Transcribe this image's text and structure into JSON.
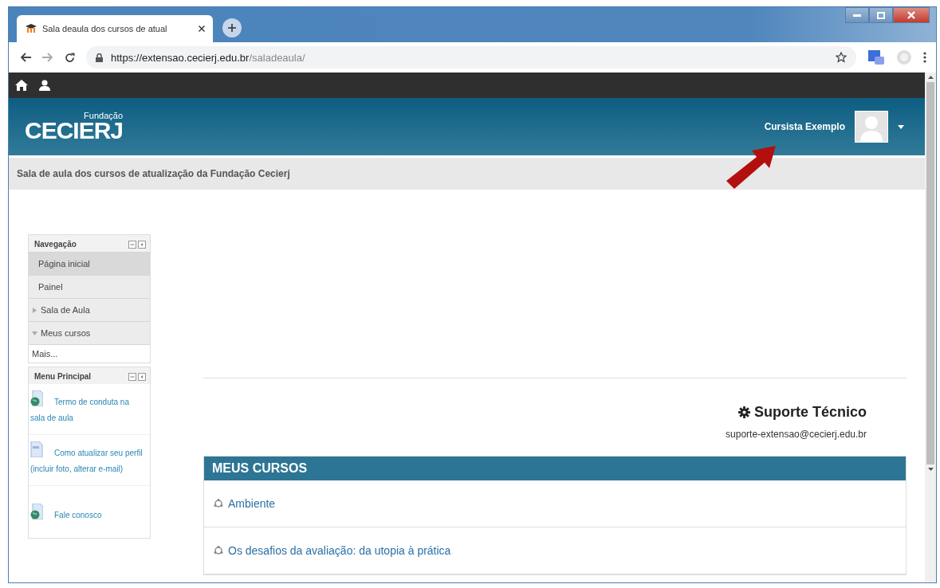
{
  "browser": {
    "tab_title": "Sala deaula dos cursos de atual",
    "url_host": "https://extensao.cecierj.edu.br",
    "url_path": "/saladeaula/"
  },
  "site_header": {
    "logo_small": "Fundação",
    "logo_big": "CECIERJ",
    "user_name": "Cursista Exemplo"
  },
  "breadcrumb": "Sala de aula dos cursos de atualização da Fundação Cecierj",
  "navigation": {
    "title": "Navegação",
    "items": [
      {
        "label": "Página inicial",
        "kind": "leaf",
        "selected": true
      },
      {
        "label": "Painel",
        "kind": "leaf",
        "selected": false
      },
      {
        "label": "Sala de Aula",
        "kind": "branch",
        "expanded": false,
        "selected": false
      },
      {
        "label": "Meus cursos",
        "kind": "branch",
        "expanded": true,
        "selected": false
      },
      {
        "label": "Mais...",
        "kind": "more",
        "selected": false
      }
    ]
  },
  "main_menu": {
    "title": "Menu Principal",
    "items": [
      {
        "label": "Termo de conduta na sala de aula",
        "kind": "url"
      },
      {
        "label": "Como atualizar seu perfil (incluir foto, alterar e-mail)",
        "kind": "file"
      },
      {
        "label": "Fale conosco",
        "kind": "url"
      }
    ]
  },
  "support": {
    "title": "Suporte Técnico",
    "email": "suporte-extensao@cecierj.edu.br"
  },
  "courses": {
    "title": "MEUS CURSOS",
    "items": [
      "Ambiente",
      "Os desafios da avaliação: da utopia à prática"
    ]
  }
}
